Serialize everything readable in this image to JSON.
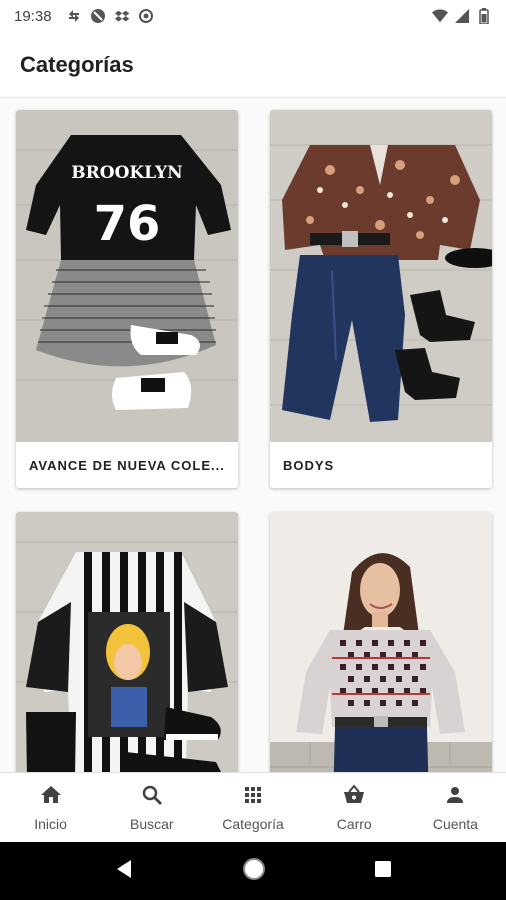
{
  "status_bar": {
    "time": "19:38",
    "left_icons": [
      "sync-icon",
      "no-camera-icon",
      "dropbox-icon",
      "data-saver-icon"
    ],
    "right_icons": [
      "wifi-icon",
      "signal-icon",
      "battery-icon"
    ]
  },
  "app_bar": {
    "title": "Categorías"
  },
  "categories": [
    {
      "label": "AVANCE DE NUEVA COLE..."
    },
    {
      "label": "BODYS"
    },
    {
      "label": ""
    },
    {
      "label": ""
    }
  ],
  "bottom_nav": {
    "items": [
      {
        "label": "Inicio",
        "icon": "home-icon"
      },
      {
        "label": "Buscar",
        "icon": "search-icon"
      },
      {
        "label": "Categoría",
        "icon": "grid-icon"
      },
      {
        "label": "Carro",
        "icon": "basket-icon"
      },
      {
        "label": "Cuenta",
        "icon": "person-icon"
      }
    ]
  },
  "colors": {
    "accent": "#212121",
    "nav_icon": "#424242",
    "background": "#ffffff"
  }
}
